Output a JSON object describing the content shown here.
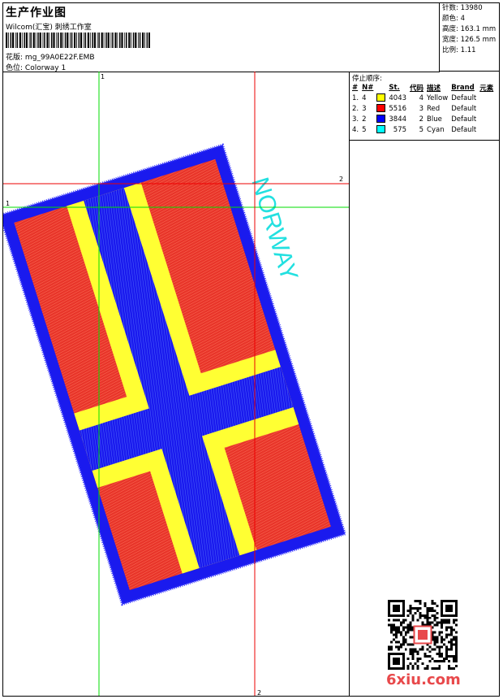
{
  "header": {
    "title": "生产作业图",
    "studio": "Wilcom(汇宝) 刺绣工作室",
    "design_label": "花版:",
    "design_file": "mg_99A0E22F.EMB",
    "colorway_label": "色位:",
    "colorway": "Colorway 1"
  },
  "stats": {
    "stitches_label": "针数:",
    "stitches": "13980",
    "colors_label": "颜色:",
    "colors": "4",
    "height_label": "高度:",
    "height": "163.1 mm",
    "width_label": "宽度:",
    "width": "126.5 mm",
    "scale_label": "比例:",
    "scale": "1.11"
  },
  "stop_sequence": {
    "title": "停止顺序:",
    "columns": [
      "#",
      "N#",
      "St.",
      "代码",
      "描述",
      "Brand",
      "元素"
    ],
    "rows": [
      {
        "num": "1.",
        "n": "4",
        "color": "#ffff00",
        "st": "4043",
        "code": "4",
        "desc": "Yellow",
        "brand": "Default"
      },
      {
        "num": "2.",
        "n": "3",
        "color": "#ff0000",
        "st": "5516",
        "code": "3",
        "desc": "Red",
        "brand": "Default"
      },
      {
        "num": "3.",
        "n": "2",
        "color": "#0000ff",
        "st": "3844",
        "code": "2",
        "desc": "Blue",
        "brand": "Default"
      },
      {
        "num": "4.",
        "n": "5",
        "color": "#00ffff",
        "st": "575",
        "code": "5",
        "desc": "Cyan",
        "brand": "Default"
      }
    ]
  },
  "canvas": {
    "guide_x1_label": "1",
    "guide_x2_label": "2",
    "guide_y1_label": "1",
    "guide_y2_label": "2",
    "flag_text": "NORWAY",
    "colors": {
      "red": "#e8352a",
      "blue": "#1a1aee",
      "yellow": "#ffff33",
      "cyan": "#22e0e0",
      "guide_green": "#00dd00",
      "guide_red": "#ee0000"
    }
  },
  "watermark": "6xiu.com"
}
